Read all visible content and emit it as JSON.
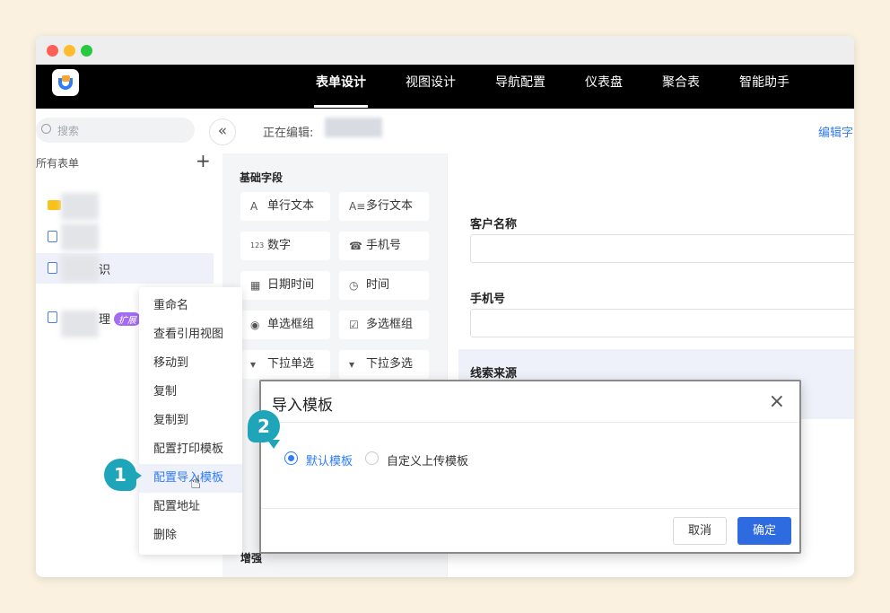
{
  "topnav": {
    "tabs": [
      {
        "label": "表单设计"
      },
      {
        "label": "视图设计"
      },
      {
        "label": "导航配置"
      },
      {
        "label": "仪表盘"
      },
      {
        "label": "聚合表"
      },
      {
        "label": "智能助手"
      }
    ]
  },
  "sidebar": {
    "search_placeholder": "搜索",
    "all_forms": "所有表单",
    "items": [
      {
        "label": ""
      },
      {
        "label": ""
      },
      {
        "label": "识"
      },
      {
        "label": "理",
        "badge": "扩展"
      }
    ]
  },
  "editbar": {
    "editing_label": "正在编辑:",
    "tab_label": "编辑字"
  },
  "fields": {
    "section_title": "基础字段",
    "buttons": [
      {
        "icon": "A",
        "label": "单行文本"
      },
      {
        "icon": "A≡",
        "label": "多行文本"
      },
      {
        "icon": "123",
        "label": "数字"
      },
      {
        "icon": "☎",
        "label": "手机号"
      },
      {
        "icon": "▦",
        "label": "日期时间"
      },
      {
        "icon": "◷",
        "label": "时间"
      },
      {
        "icon": "◉",
        "label": "单选框组"
      },
      {
        "icon": "☑",
        "label": "多选框组"
      },
      {
        "icon": "▾",
        "label": "下拉单选"
      },
      {
        "icon": "▾",
        "label": "下拉多选"
      }
    ],
    "partial_section": "增强"
  },
  "canvas": {
    "fields": [
      {
        "label": "客户名称"
      },
      {
        "label": "手机号"
      },
      {
        "label": "线索来源"
      }
    ]
  },
  "context_menu": {
    "items": [
      {
        "label": "重命名"
      },
      {
        "label": "查看引用视图"
      },
      {
        "label": "移动到"
      },
      {
        "label": "复制"
      },
      {
        "label": "复制到"
      },
      {
        "label": "配置打印模板"
      },
      {
        "label": "配置导入模板"
      },
      {
        "label": "配置地址"
      },
      {
        "label": "删除"
      }
    ]
  },
  "modal": {
    "title": "导入模板",
    "options": [
      {
        "label": "默认模板",
        "selected": true
      },
      {
        "label": "自定义上传模板",
        "selected": false
      }
    ],
    "cancel_label": "取消",
    "ok_label": "确定"
  },
  "steps": {
    "one": "1",
    "two": "2"
  },
  "colors": {
    "accent": "#2f7cf6",
    "step_marker": "#1fa5b9",
    "badge": "#a36cf2"
  }
}
